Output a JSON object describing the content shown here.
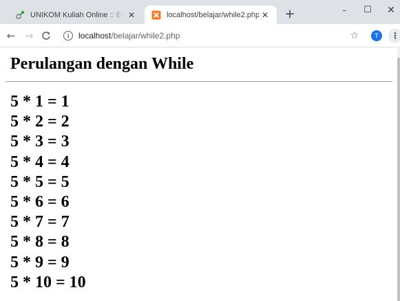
{
  "tabs": [
    {
      "title": "UNIKOM Kuliah Online :: E-Learning",
      "close": "✕",
      "favicon": "unikom-favicon-icon",
      "active": false
    },
    {
      "title": "localhost/belajar/while2.php",
      "close": "✕",
      "favicon": "xampp-favicon-icon",
      "active": true
    }
  ],
  "new_tab_label": "+",
  "window": {
    "minimize": "–",
    "maximize": "☐",
    "close": "✕"
  },
  "toolbar": {
    "back": "←",
    "forward": "→",
    "reload": "C",
    "info": "i",
    "url_host": "localhost",
    "url_path": "/belajar/while2.php",
    "star": "☆",
    "profile_initial": "T",
    "menu": "⋮"
  },
  "page": {
    "title": "Perulangan dengan While",
    "lines": [
      "5 * 1 = 1",
      "5 * 2 = 2",
      "5 * 3 = 3",
      "5 * 4 = 4",
      "5 * 5 = 5",
      "5 * 6 = 6",
      "5 * 7 = 7",
      "5 * 8 = 8",
      "5 * 9 = 9",
      "5 * 10 = 10"
    ]
  },
  "colors": {
    "tabstrip": "#dee1e6",
    "profile": "#1a73e8",
    "xampp": "#fb7a24"
  }
}
